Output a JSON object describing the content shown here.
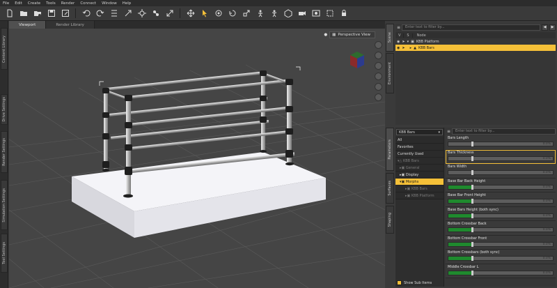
{
  "menu": [
    "File",
    "Edit",
    "Create",
    "Tools",
    "Render",
    "Connect",
    "Window",
    "Help"
  ],
  "toolbar_icons": [
    "new-file-icon",
    "open-folder-icon",
    "open-folder-recent-icon",
    "save-icon",
    "save-as-icon",
    "undo-icon",
    "redo-icon",
    "align-icon",
    "node-scale-icon",
    "transform-icon",
    "joint-editor-icon",
    "translate-icon",
    "rotate-icon",
    "scale-icon",
    "universal-icon",
    "figure-icon",
    "geometry-icon",
    "surface-icon",
    "pose-icon",
    "node-icon",
    "camera-icon",
    "render-icon",
    "spot-render-icon",
    "lock-icon"
  ],
  "left_tabs": [
    "Content Library",
    "Drive Settings",
    "Render Settings",
    "Simulation Settings",
    "Tool Settings"
  ],
  "viewport": {
    "tabs": [
      "Viewport",
      "Render Library"
    ],
    "active_tab": "Viewport",
    "camera": "Perspective View"
  },
  "right_tabs_top": [
    "Scene",
    "Environment"
  ],
  "right_tabs_bottom": [
    "Parameters",
    "Surfaces",
    "Shaping"
  ],
  "scene": {
    "filter_placeholder": "Enter text to filter by...",
    "columns": [
      "V",
      "S",
      "Node"
    ],
    "nodes": [
      {
        "label": "KBB Platform",
        "selected": false
      },
      {
        "label": "KBB Bars",
        "selected": true
      }
    ]
  },
  "parameters": {
    "node_select": "KBB Bars",
    "filter_placeholder": "Enter text to filter by...",
    "tree": [
      {
        "label": "All",
        "style": "plain"
      },
      {
        "label": "Favorites",
        "style": "plain"
      },
      {
        "label": "Currently Used",
        "style": "plain"
      },
      {
        "label": "KBB Bars",
        "style": "dim"
      },
      {
        "label": "General",
        "style": "dim"
      },
      {
        "label": "Display",
        "style": "plain"
      },
      {
        "label": "Morphs",
        "style": "hl"
      },
      {
        "label": "KBB Bars",
        "style": "dim"
      },
      {
        "label": "KBB Platform",
        "style": "dim"
      }
    ],
    "show_sub_items": "Show Sub Items",
    "list": [
      {
        "name": "Bars Length",
        "value": "0.0%",
        "fill": 0.0
      },
      {
        "name": "Bars Thickness",
        "value": "0.0%",
        "fill": 0.0
      },
      {
        "name": "Bars Width",
        "value": "0.0%",
        "fill": 0.0
      },
      {
        "name": "Base Bar Back Height",
        "value": "0.0%",
        "fill": 0.22
      },
      {
        "name": "Base Bar Front Height",
        "value": "0.0%",
        "fill": 0.22
      },
      {
        "name": "Base Bars Height (both sync)",
        "value": "0.0%",
        "fill": 0.22
      },
      {
        "name": "Bottom Crossbar Back",
        "value": "0.0%",
        "fill": 0.22
      },
      {
        "name": "Bottom Crossbar Front",
        "value": "0.0%",
        "fill": 0.22
      },
      {
        "name": "Bottom Crossbars (both sync)",
        "value": "0.0%",
        "fill": 0.22
      },
      {
        "name": "Middle Crossbar L",
        "value": "0.0%",
        "fill": 0.22
      }
    ]
  },
  "colors": {
    "accent": "#f5c038",
    "slider_green": "#1f8a2e"
  }
}
